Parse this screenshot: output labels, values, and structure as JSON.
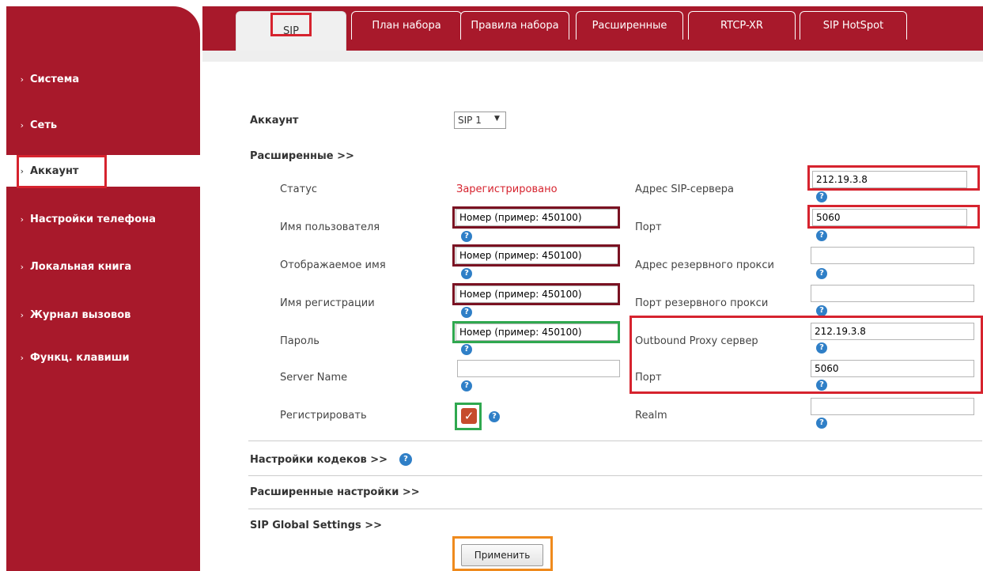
{
  "sidebar": {
    "items": [
      {
        "label": "Система"
      },
      {
        "label": "Сеть"
      },
      {
        "label": "Аккаунт"
      },
      {
        "label": "Настройки телефона"
      },
      {
        "label": "Локальная книга"
      },
      {
        "label": "Журнал вызовов"
      },
      {
        "label": "Функц. клавиши"
      }
    ]
  },
  "tabs": [
    "SIP",
    "План набора",
    "Правила набора",
    "Расширенные",
    "RTCP-XR",
    "SIP HotSpot"
  ],
  "form": {
    "account_label": "Аккаунт",
    "account_value": "SIP 1",
    "advanced_link": "Расширенные >>",
    "status_label": "Статус",
    "status_value": "Зарегистрировано",
    "username_label": "Имя пользователя",
    "username_value": "Номер (пример: 450100)",
    "display_label": "Отображаемое имя",
    "display_value": "Номер (пример: 450100)",
    "reg_name_label": "Имя регистрации",
    "reg_name_value": "Номер (пример: 450100)",
    "password_label": "Пароль",
    "password_value": "Номер (пример: 450100)",
    "server_name_label": "Server Name",
    "server_name_value": "",
    "register_label": "Регистрировать",
    "sip_server_label": "Адрес SIP-сервера",
    "sip_server_value": "212.19.3.8",
    "port_label": "Порт",
    "port_value": "5060",
    "backup_proxy_label": "Адрес резервного прокси",
    "backup_proxy_value": "",
    "backup_port_label": "Порт резервного прокси",
    "backup_port_value": "",
    "outbound_label": "Outbound Proxy сервер",
    "outbound_value": "212.19.3.8",
    "outbound_port_label": "Порт",
    "outbound_port_value": "5060",
    "realm_label": "Realm",
    "realm_value": ""
  },
  "sections": {
    "codecs": "Настройки кодеков >>",
    "advanced_settings": "Расширенные настройки >>",
    "global": "SIP Global Settings >>"
  },
  "apply_label": "Применить"
}
